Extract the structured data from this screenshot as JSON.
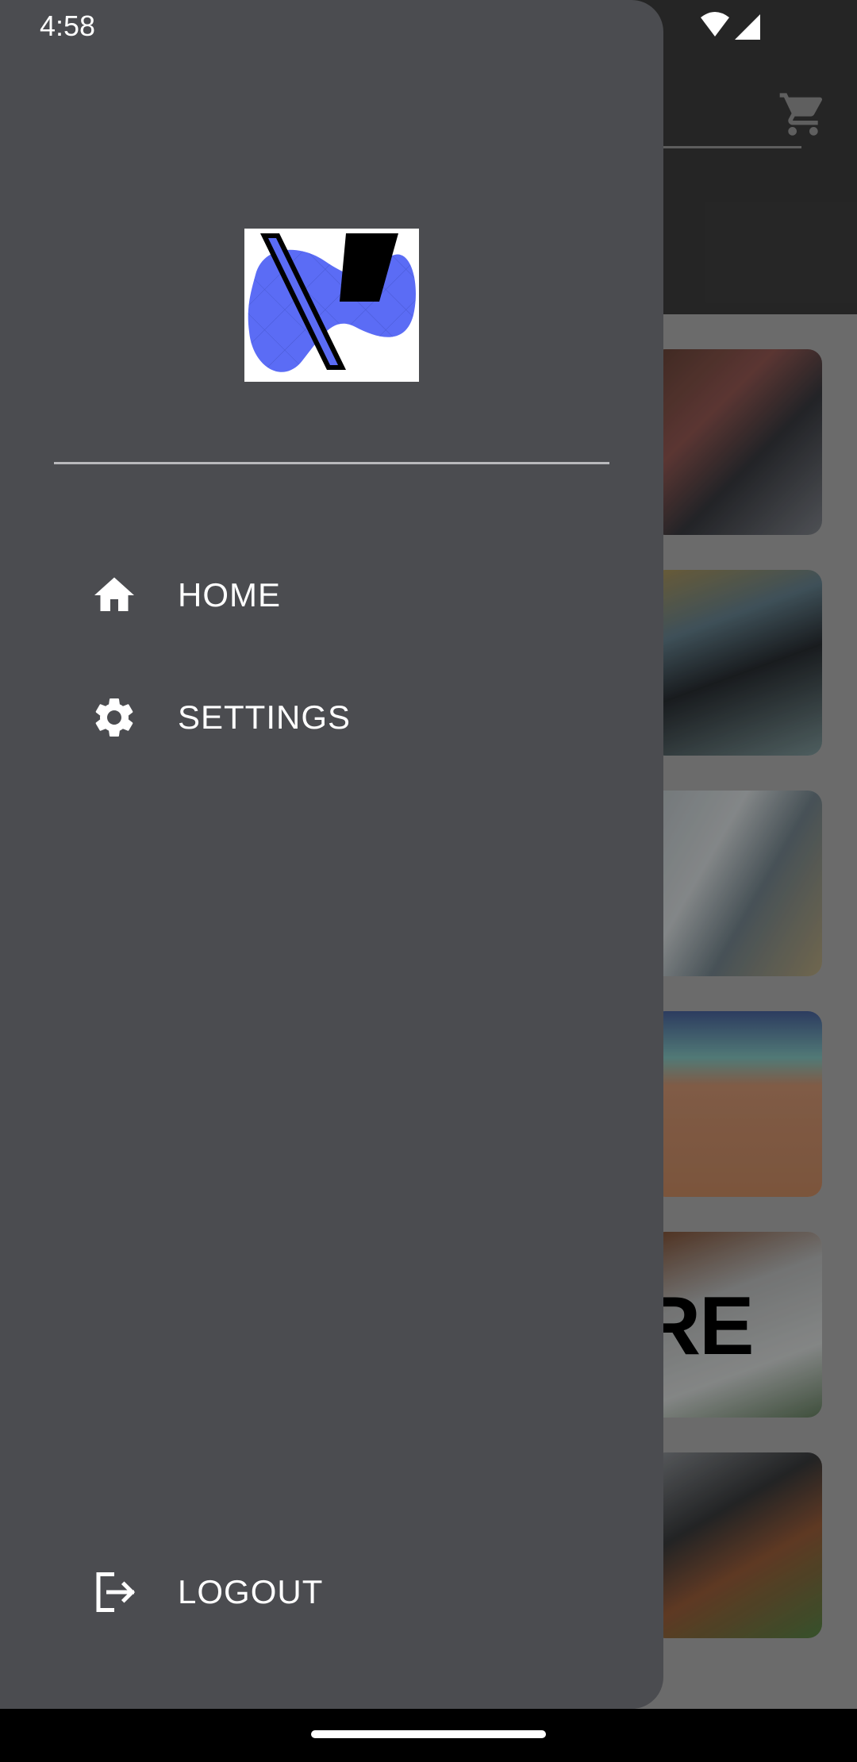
{
  "status_bar": {
    "time": "4:58"
  },
  "drawer": {
    "menu": [
      {
        "label": "HOME",
        "icon": "home-icon"
      },
      {
        "label": "SETTINGS",
        "icon": "gear-icon"
      }
    ],
    "logout_label": "LOGOUT"
  },
  "background_app": {
    "banner_text": "RE"
  },
  "colors": {
    "drawer_bg": "#4b4c50",
    "appbar_bg": "#2b2b2b",
    "logo_blue": "#5b6cf5"
  }
}
